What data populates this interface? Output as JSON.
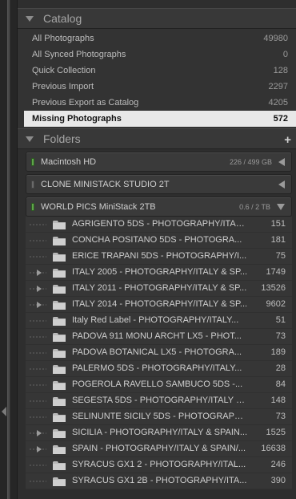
{
  "catalog": {
    "title": "Catalog",
    "items": [
      {
        "label": "All Photographs",
        "count": "49980",
        "selected": false
      },
      {
        "label": "All Synced Photographs",
        "count": "0",
        "selected": false
      },
      {
        "label": "Quick Collection",
        "count": "128",
        "selected": false
      },
      {
        "label": "Previous Import",
        "count": "2297",
        "selected": false
      },
      {
        "label": "Previous Export as Catalog",
        "count": "4205",
        "selected": false
      },
      {
        "label": "Missing Photographs",
        "count": "572",
        "selected": true
      }
    ]
  },
  "folders": {
    "title": "Folders",
    "add_label": "+",
    "volumes": [
      {
        "name": "Macintosh HD",
        "size": "226 / 499 GB",
        "status": "online"
      },
      {
        "name": "CLONE MINISTACK STUDIO 2T",
        "size": "",
        "status": "offline"
      },
      {
        "name": "WORLD PICS MiniStack 2TB",
        "size": "0.6 / 2 TB",
        "status": "online"
      }
    ],
    "items": [
      {
        "name": "AGRIGENTO 5DS - PHOTOGRAPHY/ITAL...",
        "count": "151",
        "expandable": false
      },
      {
        "name": "CONCHA POSITANO 5DS - PHOTOGRA...",
        "count": "181",
        "expandable": false
      },
      {
        "name": "ERICE TRAPANI 5DS - PHOTOGRAPHY/I...",
        "count": "75",
        "expandable": false
      },
      {
        "name": "ITALY 2005 - PHOTOGRAPHY/ITALY & SP...",
        "count": "1749",
        "expandable": true
      },
      {
        "name": "ITALY 2011 - PHOTOGRAPHY/ITALY & SP...",
        "count": "13526",
        "expandable": true
      },
      {
        "name": "ITALY 2014 - PHOTOGRAPHY/ITALY & SP...",
        "count": "9602",
        "expandable": true
      },
      {
        "name": "Italy Red Label - PHOTOGRAPHY/ITALY...",
        "count": "51",
        "expandable": false
      },
      {
        "name": "PADOVA 911 MONU ARCHT LX5 - PHOT...",
        "count": "73",
        "expandable": false
      },
      {
        "name": "PADOVA BOTANICAL LX5 - PHOTOGRA...",
        "count": "189",
        "expandable": false
      },
      {
        "name": "PALERMO 5DS - PHOTOGRAPHY/ITALY...",
        "count": "28",
        "expandable": false
      },
      {
        "name": "POGEROLA RAVELLO SAMBUCO 5DS -...",
        "count": "84",
        "expandable": false
      },
      {
        "name": "SEGESTA 5DS - PHOTOGRAPHY/ITALY &...",
        "count": "148",
        "expandable": false
      },
      {
        "name": "SELINUNTE SICILY 5DS - PHOTOGRAPH...",
        "count": "73",
        "expandable": false
      },
      {
        "name": "SICILIA - PHOTOGRAPHY/ITALY & SPAIN...",
        "count": "1525",
        "expandable": true
      },
      {
        "name": "SPAIN - PHOTOGRAPHY/ITALY & SPAIN/...",
        "count": "16638",
        "expandable": true
      },
      {
        "name": "SYRACUS GX1 2 - PHOTOGRAPHY/ITAL...",
        "count": "246",
        "expandable": false
      },
      {
        "name": "SYRACUS GX1 2B - PHOTOGRAPHY/ITA...",
        "count": "390",
        "expandable": false
      }
    ]
  },
  "colors": {
    "panel_bg": "#2e2e2e",
    "selected_bg": "#e8e8e8",
    "online_led": "#5fa54a"
  }
}
